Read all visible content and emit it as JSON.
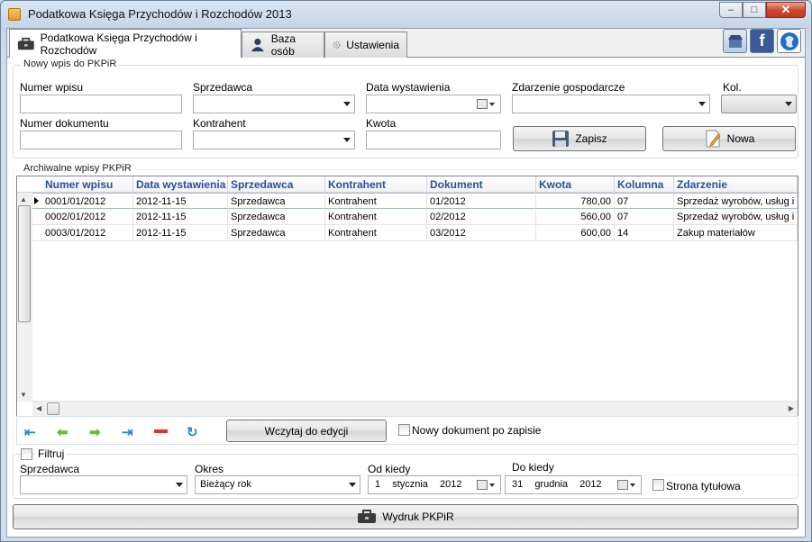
{
  "window": {
    "title": "Podatkowa Księga Przychodów i Rozchodów 2013",
    "minimize": "‒",
    "maximize": "□",
    "close": "✕"
  },
  "tabs": [
    {
      "label": "Podatkowa Księga Przychodów i Rozchodów",
      "icon": "briefcase-icon"
    },
    {
      "label": "Baza osób",
      "icon": "person-icon"
    },
    {
      "label": "Ustawienia",
      "icon": "gear-icon"
    }
  ],
  "top_icons": [
    "shop-icon",
    "facebook-icon",
    "globe-icon"
  ],
  "entry": {
    "group_title": "Nowy wpis do PKPiR",
    "numer_wpisu_label": "Numer wpisu",
    "numer_wpisu_value": "",
    "sprzedawca_label": "Sprzedawca",
    "sprzedawca_value": "",
    "data_wystawienia_label": "Data wystawienia",
    "data_wystawienia_value": "",
    "zdarzenie_label": "Zdarzenie gospodarcze",
    "zdarzenie_value": "",
    "kol_label": "Kol.",
    "kol_value": "",
    "numer_dokumentu_label": "Numer dokumentu",
    "numer_dokumentu_value": "",
    "kontrahent_label": "Kontrahent",
    "kontrahent_value": "",
    "kwota_label": "Kwota",
    "kwota_value": "",
    "zapisz_label": "Zapisz",
    "nowa_label": "Nowa"
  },
  "archive": {
    "group_title": "Archiwalne wpisy PKPiR",
    "columns": [
      "Numer wpisu",
      "Data wystawienia",
      "Sprzedawca",
      "Kontrahent",
      "Dokument",
      "Kwota",
      "Kolumna",
      "Zdarzenie"
    ],
    "rows": [
      [
        "0001/01/2012",
        "2012-11-15",
        "Sprzedawca",
        "Kontrahent",
        "01/2012",
        "780,00",
        "07",
        "Sprzedaż wyrobów, usług i t"
      ],
      [
        "0002/01/2012",
        "2012-11-15",
        "Sprzedawca",
        "Kontrahent",
        "02/2012",
        "560,00",
        "07",
        "Sprzedaż wyrobów, usług i t"
      ],
      [
        "0003/01/2012",
        "2012-11-15",
        "Sprzedawca",
        "Kontrahent",
        "03/2012",
        "600,00",
        "14",
        "Zakup materiałów"
      ]
    ]
  },
  "nav": {
    "load_label": "Wczytaj do edycji",
    "new_after_save_label": "Nowy dokument po zapisie"
  },
  "filter": {
    "title": "Filtruj",
    "sprzedawca_label": "Sprzedawca",
    "sprzedawca_value": "",
    "okres_label": "Okres",
    "okres_value": "Bieżący rok",
    "od_label": "Od kiedy",
    "od_day": "1",
    "od_month": "stycznia",
    "od_year": "2012",
    "do_label": "Do kiedy",
    "do_day": "31",
    "do_month": "grudnia",
    "do_year": "2012",
    "strona_label": "Strona tytułowa"
  },
  "print_label": "Wydruk PKPiR"
}
